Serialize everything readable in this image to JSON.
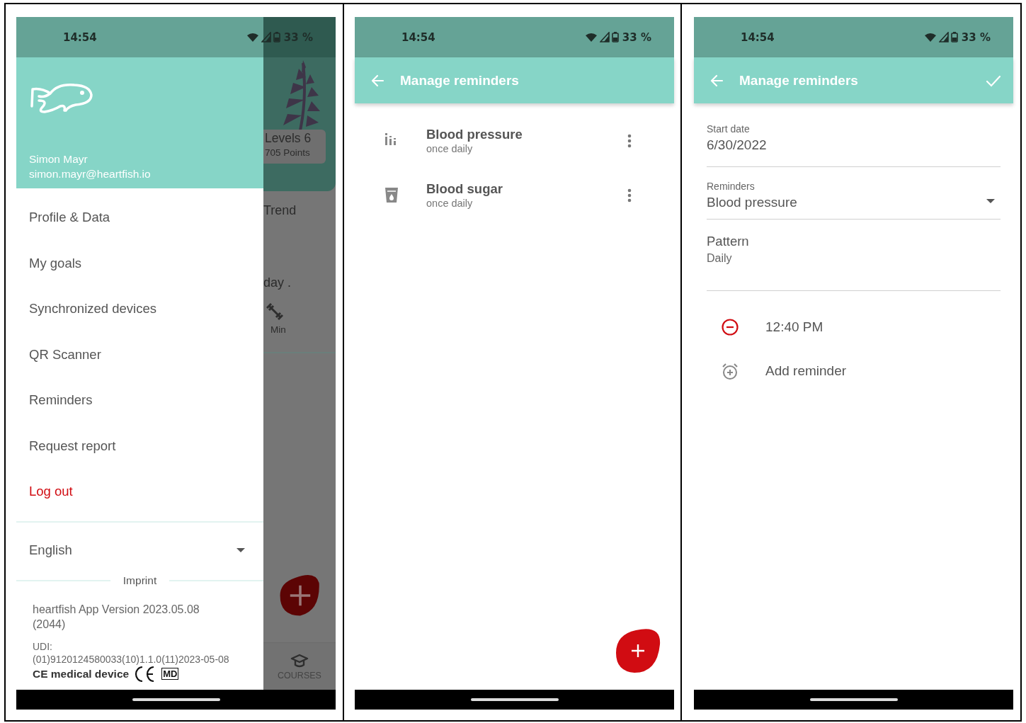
{
  "screens": [
    {
      "kind": "drawer",
      "status_bar": {
        "time": "14:54",
        "battery": "33 %"
      },
      "drawer": {
        "user_name": "Simon Mayr",
        "user_email": "simon.mayr@heartfish.io",
        "items": [
          {
            "label": "Profile & Data",
            "kind": "link"
          },
          {
            "label": "My goals",
            "kind": "link"
          },
          {
            "label": "Synchronized devices",
            "kind": "link"
          },
          {
            "label": "QR Scanner",
            "kind": "link"
          },
          {
            "label": "Reminders",
            "kind": "link"
          },
          {
            "label": "Request report",
            "kind": "link"
          },
          {
            "label": "Log out",
            "kind": "logout"
          }
        ],
        "language": "English",
        "imprint": "Imprint",
        "version": "heartfish App Version 2023.05.08 (2044)",
        "udi_label": "UDI:",
        "udi": "(01)9120124580033(10)1.1.0(11)2023-05-08",
        "certification": "CE medical device",
        "md_mark": "MD"
      },
      "behind": {
        "level": "Levels 6",
        "points": "705 Points",
        "trend": "Trend",
        "note": "day .",
        "duration": "Min",
        "nav_tab": "COURSES"
      }
    },
    {
      "kind": "list",
      "status_bar": {
        "time": "14:54",
        "battery": "33 %"
      },
      "app_bar": {
        "title": "Manage reminders",
        "confirm": false
      },
      "reminders": [
        {
          "title": "Blood pressure",
          "subtitle": "once daily",
          "kind": "chart"
        },
        {
          "title": "Blood sugar",
          "subtitle": "once daily",
          "kind": "cup"
        }
      ]
    },
    {
      "kind": "form",
      "status_bar": {
        "time": "14:54",
        "battery": "33 %"
      },
      "app_bar": {
        "title": "Manage reminders",
        "confirm": true
      },
      "start_date": {
        "label": "Start date",
        "value": "6/30/2022"
      },
      "reminder_type": {
        "label": "Reminders",
        "value": "Blood pressure"
      },
      "pattern": {
        "label": "Pattern",
        "value": "Daily"
      },
      "times": [
        {
          "time": "12:40 PM"
        }
      ],
      "add_label": "Add reminder"
    }
  ]
}
